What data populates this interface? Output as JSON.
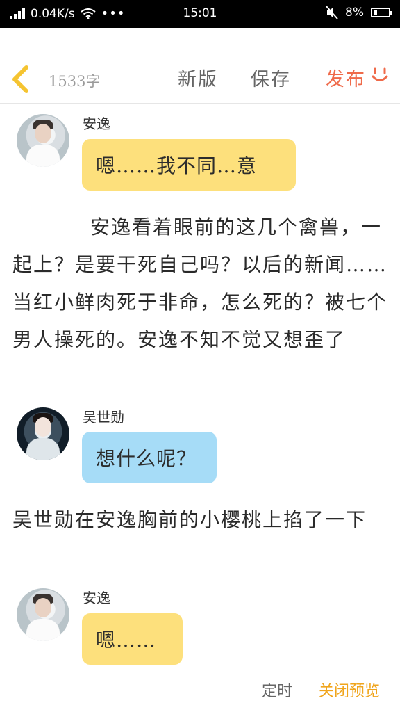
{
  "status_bar": {
    "network_speed": "0.04K/s",
    "dots": "•••",
    "time": "15:01",
    "battery": "8%",
    "battery_level": 0.08,
    "icons": [
      "signal-icon",
      "wifi-icon",
      "mute-icon",
      "battery-icon"
    ]
  },
  "toolbar": {
    "word_count": "1533字",
    "new_version_label": "新版",
    "save_label": "保存",
    "publish_label": "发布",
    "accent_color": "#ef6a4a"
  },
  "content": {
    "messages": [
      {
        "speaker": "安逸",
        "text": "嗯……我不同…意",
        "bubble_color": "#fde07c"
      },
      {
        "speaker": "吴世勋",
        "text": "想什么呢？",
        "bubble_color": "#a6dcf7"
      },
      {
        "speaker": "安逸",
        "text": "嗯……",
        "bubble_color": "#fde07c"
      }
    ],
    "paragraphs": [
      "安逸看着眼前的这几个禽兽，一起上？是要干死自己吗？以后的新闻……当红小鲜肉死于非命，怎么死的？被七个男人操死的。安逸不知不觉又想歪了",
      "吴世勋在安逸胸前的小樱桃上掐了一下"
    ]
  },
  "bottom_bar": {
    "timer_label": "定时",
    "close_preview_label": "关闭预览",
    "close_color": "#f0a51d"
  }
}
